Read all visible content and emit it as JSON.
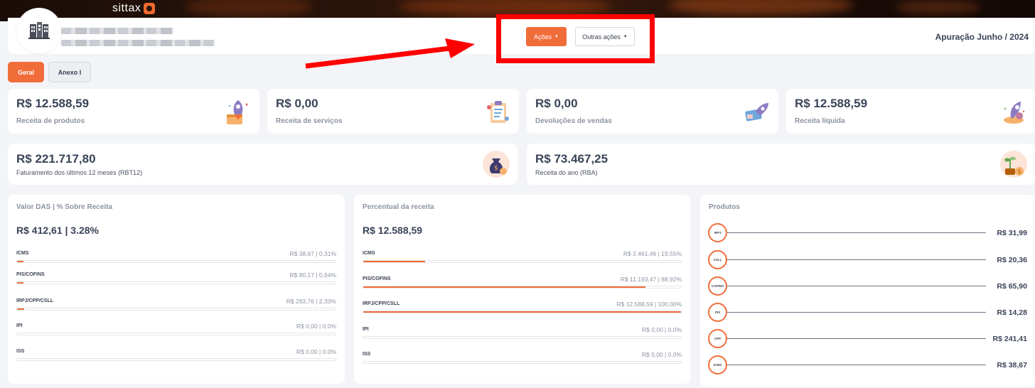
{
  "app": {
    "brand": "sittax"
  },
  "header": {
    "period": "Apuração Junho / 2024",
    "actions_label": "Ações",
    "other_actions_label": "Outras ações"
  },
  "tabs": [
    {
      "label": "Geral",
      "active": true
    },
    {
      "label": "Anexo I",
      "active": false
    }
  ],
  "kpis": [
    {
      "value": "R$ 12.588,59",
      "label": "Receita de produtos",
      "icon": "rocket-box-icon"
    },
    {
      "value": "R$ 0,00",
      "label": "Receita de serviços",
      "icon": "clipboard-icon"
    },
    {
      "value": "R$ 0,00",
      "label": "Devoluções de vendas",
      "icon": "return-rocket-icon"
    },
    {
      "value": "R$ 12.588,59",
      "label": "Receita líquida",
      "icon": "rocket-cash-icon"
    }
  ],
  "kpis_wide": [
    {
      "value": "R$ 221.717,80",
      "label": "Faturamento dos últimos 12 meses (RBT12)",
      "icon": "money-bag-icon"
    },
    {
      "value": "R$ 73.467,25",
      "label": "Receita do ano (RBA)",
      "icon": "plant-coins-icon"
    }
  ],
  "das_panel": {
    "title": "Valor DAS | % Sobre Receita",
    "total": "R$ 412,61 | 3.28%",
    "rows": [
      {
        "name": "ICMS",
        "value": "R$ 38,67 | 0,31%",
        "fill": 0.0031
      },
      {
        "name": "PIS/COFINS",
        "value": "R$ 80,17 | 0,64%",
        "fill": 0.0064
      },
      {
        "name": "IRPJ/CPP/CSLL",
        "value": "R$ 293,76 | 2,33%",
        "fill": 0.0233
      },
      {
        "name": "IPI",
        "value": "R$ 0,00 | 0.0%",
        "fill": 0
      },
      {
        "name": "ISS",
        "value": "R$ 0,00 | 0.0%",
        "fill": 0
      }
    ]
  },
  "revenue_panel": {
    "title": "Percentual da receita",
    "total": "R$ 12.588,59",
    "rows": [
      {
        "name": "ICMS",
        "value": "R$ 2.461,46 | 19,55%",
        "fill": 0.1955
      },
      {
        "name": "PIS/COFINS",
        "value": "R$ 11.193,47 | 88,92%",
        "fill": 0.8892
      },
      {
        "name": "IRPJ/CPP/CSLL",
        "value": "R$ 12.588,59 | 100,00%",
        "fill": 1.0
      },
      {
        "name": "IPI",
        "value": "R$ 0,00 | 0.0%",
        "fill": 0
      },
      {
        "name": "ISS",
        "value": "R$ 0,00 | 0.0%",
        "fill": 0
      }
    ]
  },
  "products_panel": {
    "title": "Produtos",
    "rows": [
      {
        "name": "IRPJ",
        "value": "R$ 31,99"
      },
      {
        "name": "CSLL",
        "value": "R$ 20,36"
      },
      {
        "name": "COFINS",
        "value": "R$ 65,90"
      },
      {
        "name": "PIS",
        "value": "R$ 14,28"
      },
      {
        "name": "CPP",
        "value": "R$ 241,41"
      },
      {
        "name": "ICMS",
        "value": "R$ 38,67"
      }
    ]
  },
  "colors": {
    "accent": "#f06d3a",
    "highlight": "#ff0000",
    "text": "#3a4358",
    "muted": "#8b93a1"
  }
}
